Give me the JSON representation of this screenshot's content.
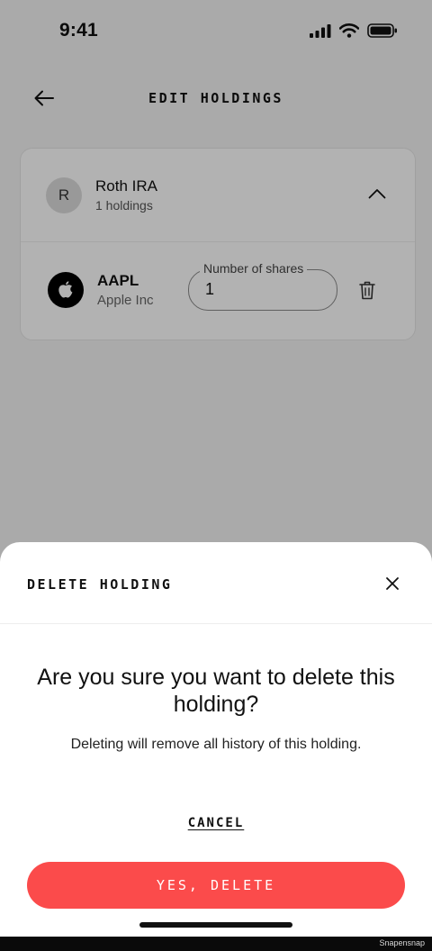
{
  "status_bar": {
    "time": "9:41",
    "icons": [
      "cellular-signal-icon",
      "wifi-icon",
      "battery-icon"
    ]
  },
  "header": {
    "title": "EDIT HOLDINGS",
    "back_icon": "arrow-left-icon"
  },
  "account": {
    "avatar_letter": "R",
    "name": "Roth IRA",
    "count": "1 holdings",
    "toggle_icon": "chevron-up-icon",
    "holdings": [
      {
        "ticker": "AAPL",
        "company": "Apple Inc",
        "logo_icon": "apple-logo-icon",
        "shares_label": "Number of shares",
        "shares_value": "1",
        "delete_icon": "trash-icon"
      }
    ]
  },
  "sheet": {
    "title": "DELETE HOLDING",
    "close_icon": "close-icon",
    "heading": "Are you sure you want to delete this holding?",
    "body": "Deleting will remove all history of this holding.",
    "cancel_label": "CANCEL",
    "confirm_label": "YES, DELETE"
  },
  "footer": {
    "watermark": "Snapensnap"
  },
  "colors": {
    "danger": "#fb4b4b",
    "background": "#f4f4f4",
    "scrim": "rgba(0,0,0,0.30)"
  }
}
